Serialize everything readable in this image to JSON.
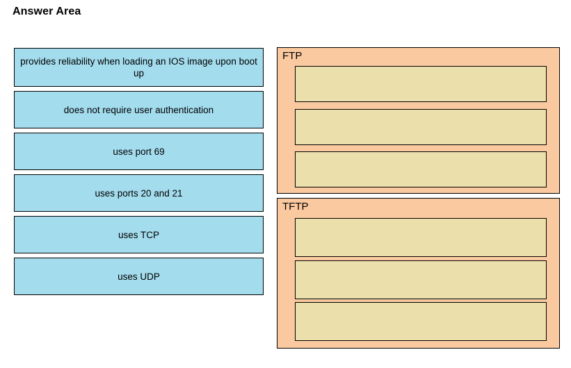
{
  "page": {
    "title": "Answer Area"
  },
  "drag_source": {
    "items": [
      {
        "label": "provides reliability when loading an IOS image upon boot up"
      },
      {
        "label": "does not require user authentication"
      },
      {
        "label": "uses port 69"
      },
      {
        "label": "uses ports 20 and 21"
      },
      {
        "label": "uses TCP"
      },
      {
        "label": "uses UDP"
      }
    ]
  },
  "drop_panels": [
    {
      "title": "FTP",
      "slots": [
        {
          "label": ""
        },
        {
          "label": ""
        },
        {
          "label": ""
        }
      ]
    },
    {
      "title": "TFTP",
      "slots": [
        {
          "label": ""
        },
        {
          "label": ""
        },
        {
          "label": ""
        }
      ]
    }
  ],
  "colors": {
    "drag_tile_fill": "#a3dced",
    "panel_fill": "#fbc9a0",
    "slot_fill": "#ebe0ac",
    "border": "#000000",
    "text": "#000000",
    "background": "#ffffff"
  }
}
